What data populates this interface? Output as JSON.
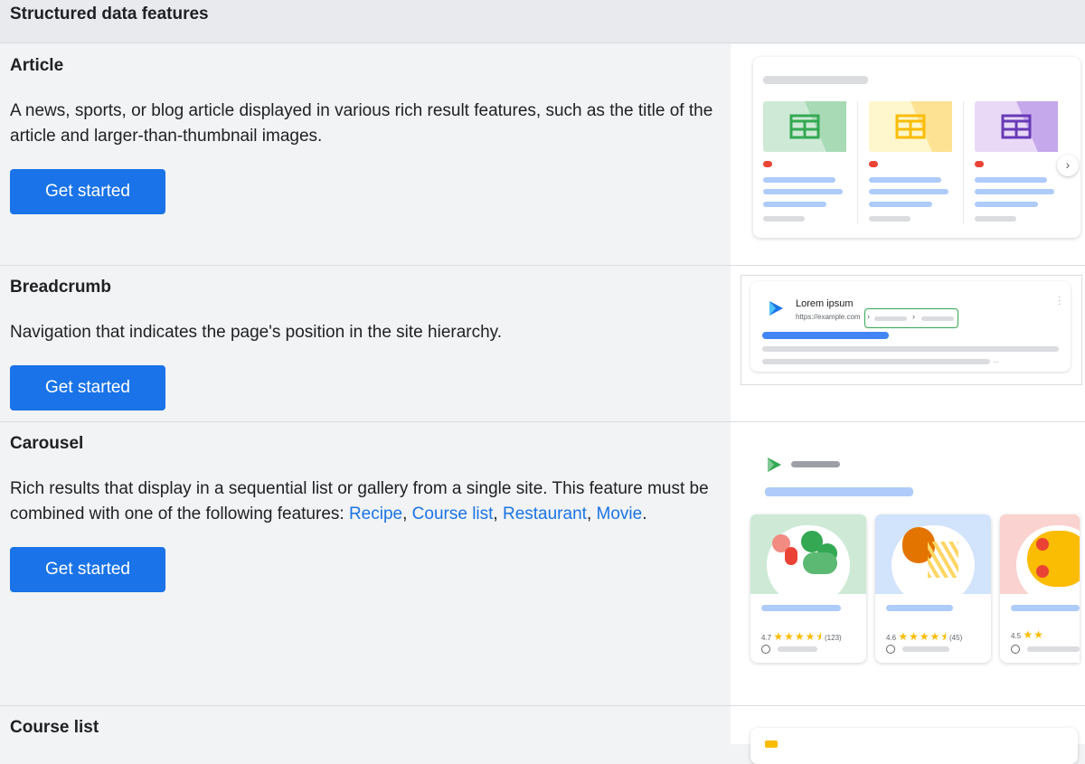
{
  "header": {
    "title": "Structured data features"
  },
  "sections": [
    {
      "title": "Article",
      "description": "A news, sports, or blog article displayed in various rich result features, such as the title of the article and larger-than-thumbnail images.",
      "button": "Get started"
    },
    {
      "title": "Breadcrumb",
      "description": "Navigation that indicates the page's position in the site hierarchy.",
      "button": "Get started",
      "preview": {
        "site_title": "Lorem ipsum",
        "url": "https://example.com"
      }
    },
    {
      "title": "Carousel",
      "description_prefix": "Rich results that display in a sequential list or gallery from a single site. This feature must be combined with one of the following features: ",
      "links": [
        "Recipe",
        "Course list",
        "Restaurant",
        "Movie"
      ],
      "separators": [
        ", ",
        ", ",
        ", ",
        "."
      ],
      "button": "Get started",
      "preview": {
        "cards": [
          {
            "rating": "4.7",
            "count": "(123)"
          },
          {
            "rating": "4.6",
            "count": "(45)"
          },
          {
            "rating": "4.5",
            "count": ""
          }
        ],
        "star_icons": [
          "★★★★⯨",
          "★★★★⯨",
          "★★"
        ]
      }
    },
    {
      "title": "Course list"
    }
  ],
  "colors": {
    "accent": "#1a73e8",
    "page_bg": "#f1f3f4",
    "header_bg": "#e8eaed",
    "link": "#1a73e8"
  }
}
